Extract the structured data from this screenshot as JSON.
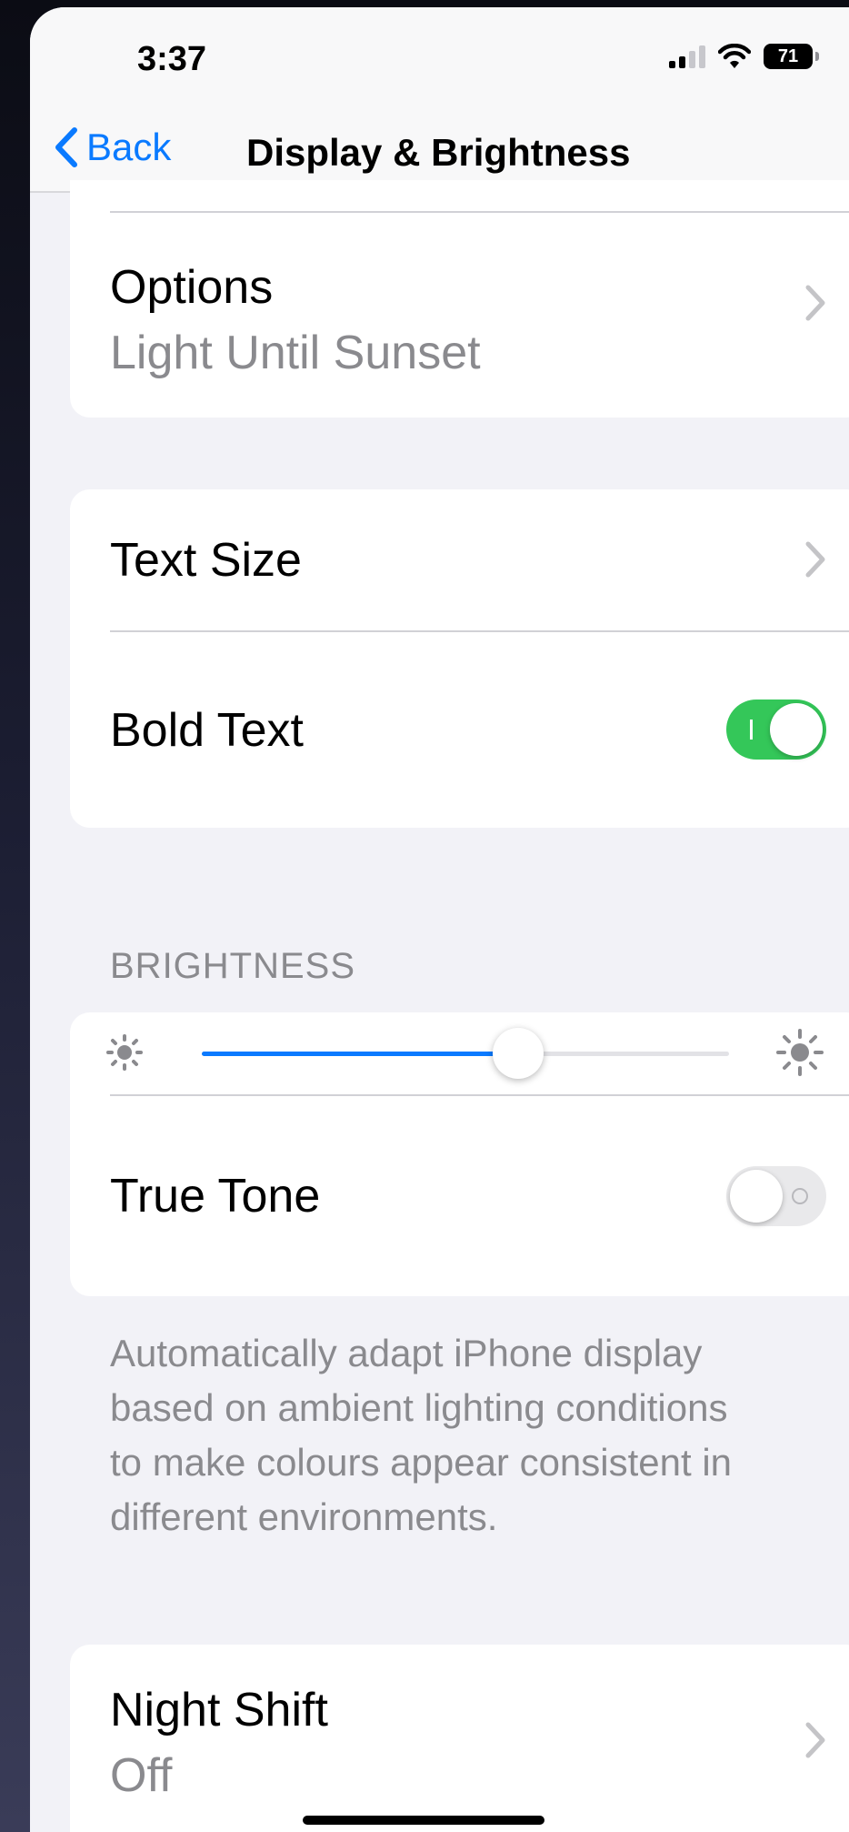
{
  "status_bar": {
    "time": "3:37",
    "battery": "71"
  },
  "nav": {
    "back_label": "Back",
    "title": "Display & Brightness"
  },
  "appearance": {
    "options_label": "Options",
    "options_value": "Light Until Sunset"
  },
  "text": {
    "text_size_label": "Text Size",
    "bold_text_label": "Bold Text",
    "bold_text_on": true
  },
  "brightness": {
    "header": "BRIGHTNESS",
    "level": 0.6,
    "true_tone_label": "True Tone",
    "true_tone_on": false,
    "footnote": "Automatically adapt iPhone display based on ambient lighting conditions to make colours appear consistent in different environments."
  },
  "night_shift": {
    "label": "Night Shift",
    "value": "Off"
  },
  "colors": {
    "accent": "#0a7aff",
    "toggle_on": "#34c759",
    "background": "#f2f2f7"
  }
}
